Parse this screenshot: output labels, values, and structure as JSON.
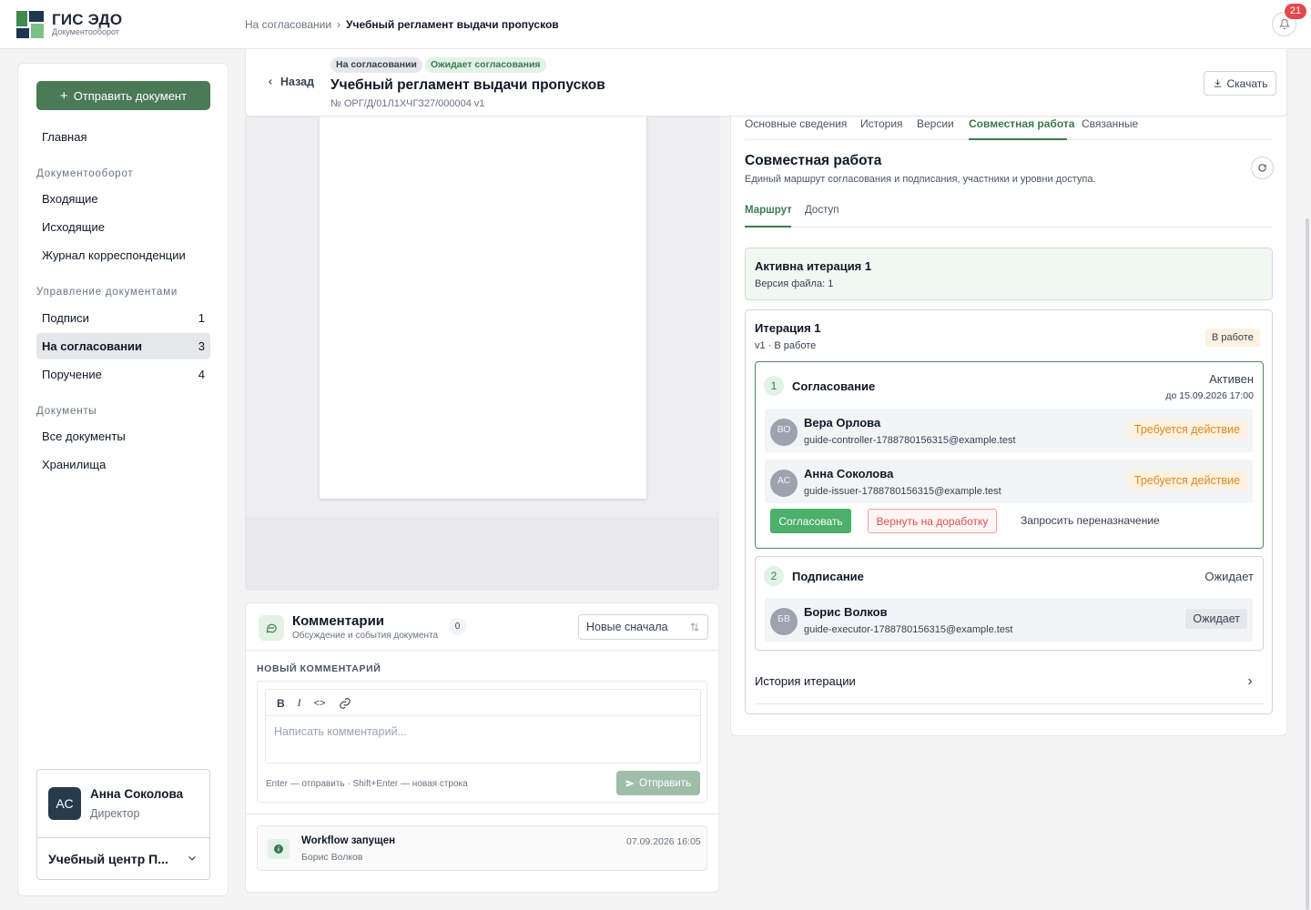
{
  "brand": {
    "title": "ГИС ЭДО",
    "subtitle": "Документооборот"
  },
  "breadcrumb": {
    "parent": "На согласовании",
    "separator": "›",
    "current": "Учебный регламент выдачи пропусков"
  },
  "notifications": {
    "count": "21"
  },
  "sidebar": {
    "send_label": "Отправить документ",
    "home": "Главная",
    "sections": [
      {
        "title": "Документооборот",
        "items": [
          {
            "label": "Входящие",
            "count": ""
          },
          {
            "label": "Исходящие",
            "count": ""
          },
          {
            "label": "Журнал корреспонденции",
            "count": ""
          }
        ]
      },
      {
        "title": "Управление документами",
        "items": [
          {
            "label": "Подписи",
            "count": "1"
          },
          {
            "label": "На согласовании",
            "count": "3"
          },
          {
            "label": "Поручение",
            "count": "4"
          }
        ]
      },
      {
        "title": "Документы",
        "items": [
          {
            "label": "Все документы",
            "count": ""
          },
          {
            "label": "Хранилища",
            "count": ""
          }
        ]
      }
    ],
    "user": {
      "initials": "АС",
      "name": "Анна Соколова",
      "role": "Директор",
      "org": "Учебный центр П..."
    }
  },
  "doc": {
    "back": "Назад",
    "status_badge": "На согласовании",
    "approval_badge": "Ожидает согласования",
    "title": "Учебный регламент выдачи пропусков",
    "number": "№ ОРГ/Д/01Л1ХЧГЗ27/000004  v1",
    "download": "Скачать"
  },
  "comments": {
    "title": "Комментарии",
    "subtitle": "Обсуждение и события документа",
    "count": "0",
    "sort": "Новые сначала",
    "new_label": "НОВЫЙ КОММЕНТАРИЙ",
    "toolbar": {
      "bold": "B",
      "italic": "I",
      "code": "<>"
    },
    "placeholder": "Написать комментарий...",
    "hint": "Enter — отправить · Shift+Enter — новая строка",
    "send": "Отправить",
    "event": {
      "title": "Workflow запущен",
      "author": "Борис Волков",
      "time": "07.09.2026 16:05"
    }
  },
  "panel": {
    "tabs": [
      "Основные сведения",
      "История",
      "Версии",
      "Совместная работа",
      "Связанные"
    ],
    "title": "Совместная работа",
    "subtitle": "Единый маршрут согласования и подписания, участники и уровни доступа.",
    "subtabs": [
      "Маршрут",
      "Доступ"
    ],
    "active_iteration": {
      "title": "Активна итерация 1",
      "file_version": "Версия файла: 1"
    },
    "iteration": {
      "title": "Итерация 1",
      "sub": "v1 · В работе",
      "badge": "В работе",
      "stages": [
        {
          "num": "1",
          "name": "Согласование",
          "status": "Активен",
          "due": "до 15.09.2026 17:00",
          "people": [
            {
              "initials": "ВО",
              "name": "Вера Орлова",
              "email": "guide-controller-1788780156315@example.test",
              "status": "Требуется действие"
            },
            {
              "initials": "АС",
              "name": "Анна Соколова",
              "email": "guide-issuer-1788780156315@example.test",
              "status": "Требуется действие"
            }
          ],
          "actions": {
            "approve": "Согласовать",
            "return": "Вернуть на доработку",
            "reassign": "Запросить переназначение"
          }
        },
        {
          "num": "2",
          "name": "Подписание",
          "status": "Ожидает",
          "people": [
            {
              "initials": "БВ",
              "name": "Борис Волков",
              "email": "guide-executor-1788780156315@example.test",
              "status": "Ожидает"
            }
          ]
        }
      ],
      "history": "История итерации"
    }
  }
}
